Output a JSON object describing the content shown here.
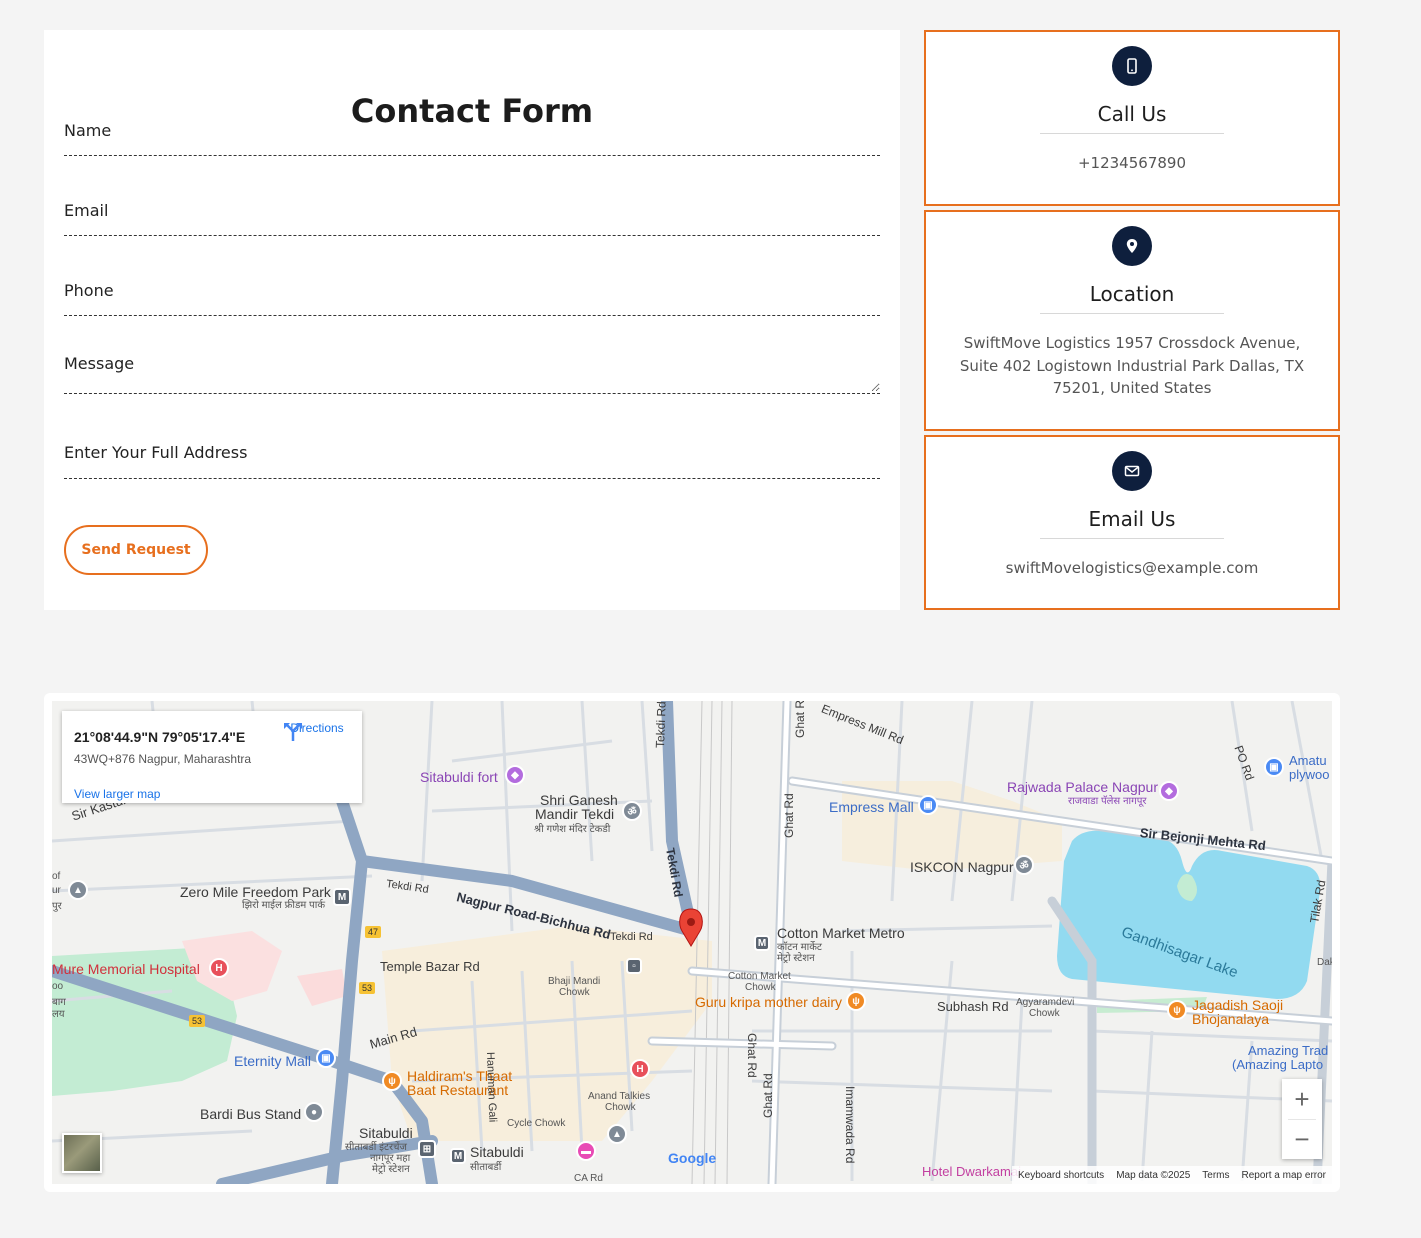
{
  "form": {
    "title": "Contact Form",
    "name_placeholder": "Name",
    "email_placeholder": "Email",
    "phone_placeholder": "Phone",
    "message_placeholder": "Message",
    "address_placeholder": "Enter Your Full Address",
    "send_label": "Send Request"
  },
  "info": {
    "call": {
      "title": "Call Us",
      "text": "+1234567890",
      "icon": "phone-icon"
    },
    "location": {
      "title": "Location",
      "text": "SwiftMove Logistics 1957 Crossdock Avenue, Suite 402 Logistown Industrial Park Dallas, TX 75201, United States",
      "icon": "location-pin-icon"
    },
    "email": {
      "title": "Email Us",
      "text": "swiftMovelogistics@example.com",
      "icon": "envelope-icon"
    }
  },
  "colors": {
    "accent": "#e76f1e",
    "icon_bg": "#0e1f3d"
  },
  "map": {
    "coords": "21°08'44.9\"N 79°05'17.4\"E",
    "address": "43WQ+876 Nagpur, Maharashtra",
    "larger_map": "View larger map",
    "directions": "Directions",
    "zoom_in": "+",
    "zoom_out": "−",
    "google": "Google",
    "attribution": {
      "shortcuts": "Keyboard shortcuts",
      "data": "Map data ©2025",
      "terms": "Terms",
      "report": "Report a map error"
    },
    "labels": {
      "sitabuldi_fort": "Sitabuldi fort",
      "shri_ganesh_1": "Shri Ganesh",
      "shri_ganesh_2": "Mandir Tekdi",
      "shri_ganesh_hi": "श्री गणेश मंदिर टेकडी",
      "kasturchand": "Sir Kasturchand Daga",
      "zero_mile_1": "Zero Mile Freedom Park",
      "zero_mile_hi": "झिरो माईल फ्रीडम पार्क",
      "tekdi_rd": "Tekdi Rd",
      "nagpur_bichhua": "Nagpur Road-Bichhua Rd",
      "temple_bazar": "Temple Bazar Rd",
      "mure_hospital": "Mure Memorial Hospital",
      "main_rd": "Main Rd",
      "eternity_mall": "Eternity Mall",
      "haldiram_1": "Haldiram's Thaat",
      "haldiram_2": "Baat Restaurant",
      "bardi_bus": "Bardi Bus Stand",
      "sitabuldi_ic_1": "Sitabuldi",
      "sitabuldi_ic_hi1": "सीताबर्डी इंटरचेंज",
      "sitabuldi_ic_hi2": "नागपूर महा",
      "sitabuldi_ic_hi3": "मेट्रो स्टेशन",
      "sitabuldi_2": "Sitabuldi",
      "sitabuldi_2_hi": "सीताबर्डी",
      "bhaji_mandi_1": "Bhaji Mandi",
      "bhaji_mandi_2": "Chowk",
      "hanuman_gali": "Hanuman Gali",
      "cycle_chowk": "Cycle Chowk",
      "anand_1": "Anand Talkies",
      "anand_2": "Chowk",
      "cotton_metro": "Cotton Market Metro",
      "cotton_metro_hi1": "कॉटन मार्केट",
      "cotton_metro_hi2": "मेट्रो स्टेशन",
      "cotton_chowk_1": "Cotton Market",
      "cotton_chowk_2": "Chowk",
      "guru_kripa": "Guru kripa mother dairy",
      "ghat_rd": "Ghat Rd",
      "empress_mall": "Empress Mall",
      "iskcon": "ISKCON Nagpur",
      "rajwada_1": "Rajwada Palace Nagpur",
      "rajwada_hi": "राजवाडा पॅलेस नागपूर",
      "bejonji": "Sir Bejonji Mehta Rd",
      "gandhisagar": "Gandhisagar Lake",
      "subhash": "Subhash Rd",
      "agyaram_1": "Agyaramdevi",
      "agyaram_2": "Chowk",
      "jagadish_1": "Jagadish Saoji",
      "jagadish_2": "Bhojanalaya",
      "amazing_1": "Amazing Trad",
      "amazing_2": "(Amazing Lapto",
      "amatu_1": "Amatu",
      "amatu_2": "plywoo",
      "po_rd": "PO Rd",
      "tilak_rd": "Tilak Rd",
      "imamwada": "Imamwada Rd",
      "hotel_dwarkamai": "Hotel Dwarkamai",
      "empress_mill": "Empress Mill Rd",
      "ca_rd": "CA Rd",
      "dak": "Dak",
      "road_53a": "53",
      "road_53b": "53",
      "road_47": "47",
      "left_of": "of",
      "left_ur": "ur",
      "left_pur": "पुर",
      "left_oo": "oo",
      "left_bag": "बाग",
      "left_lay": "लय"
    }
  }
}
